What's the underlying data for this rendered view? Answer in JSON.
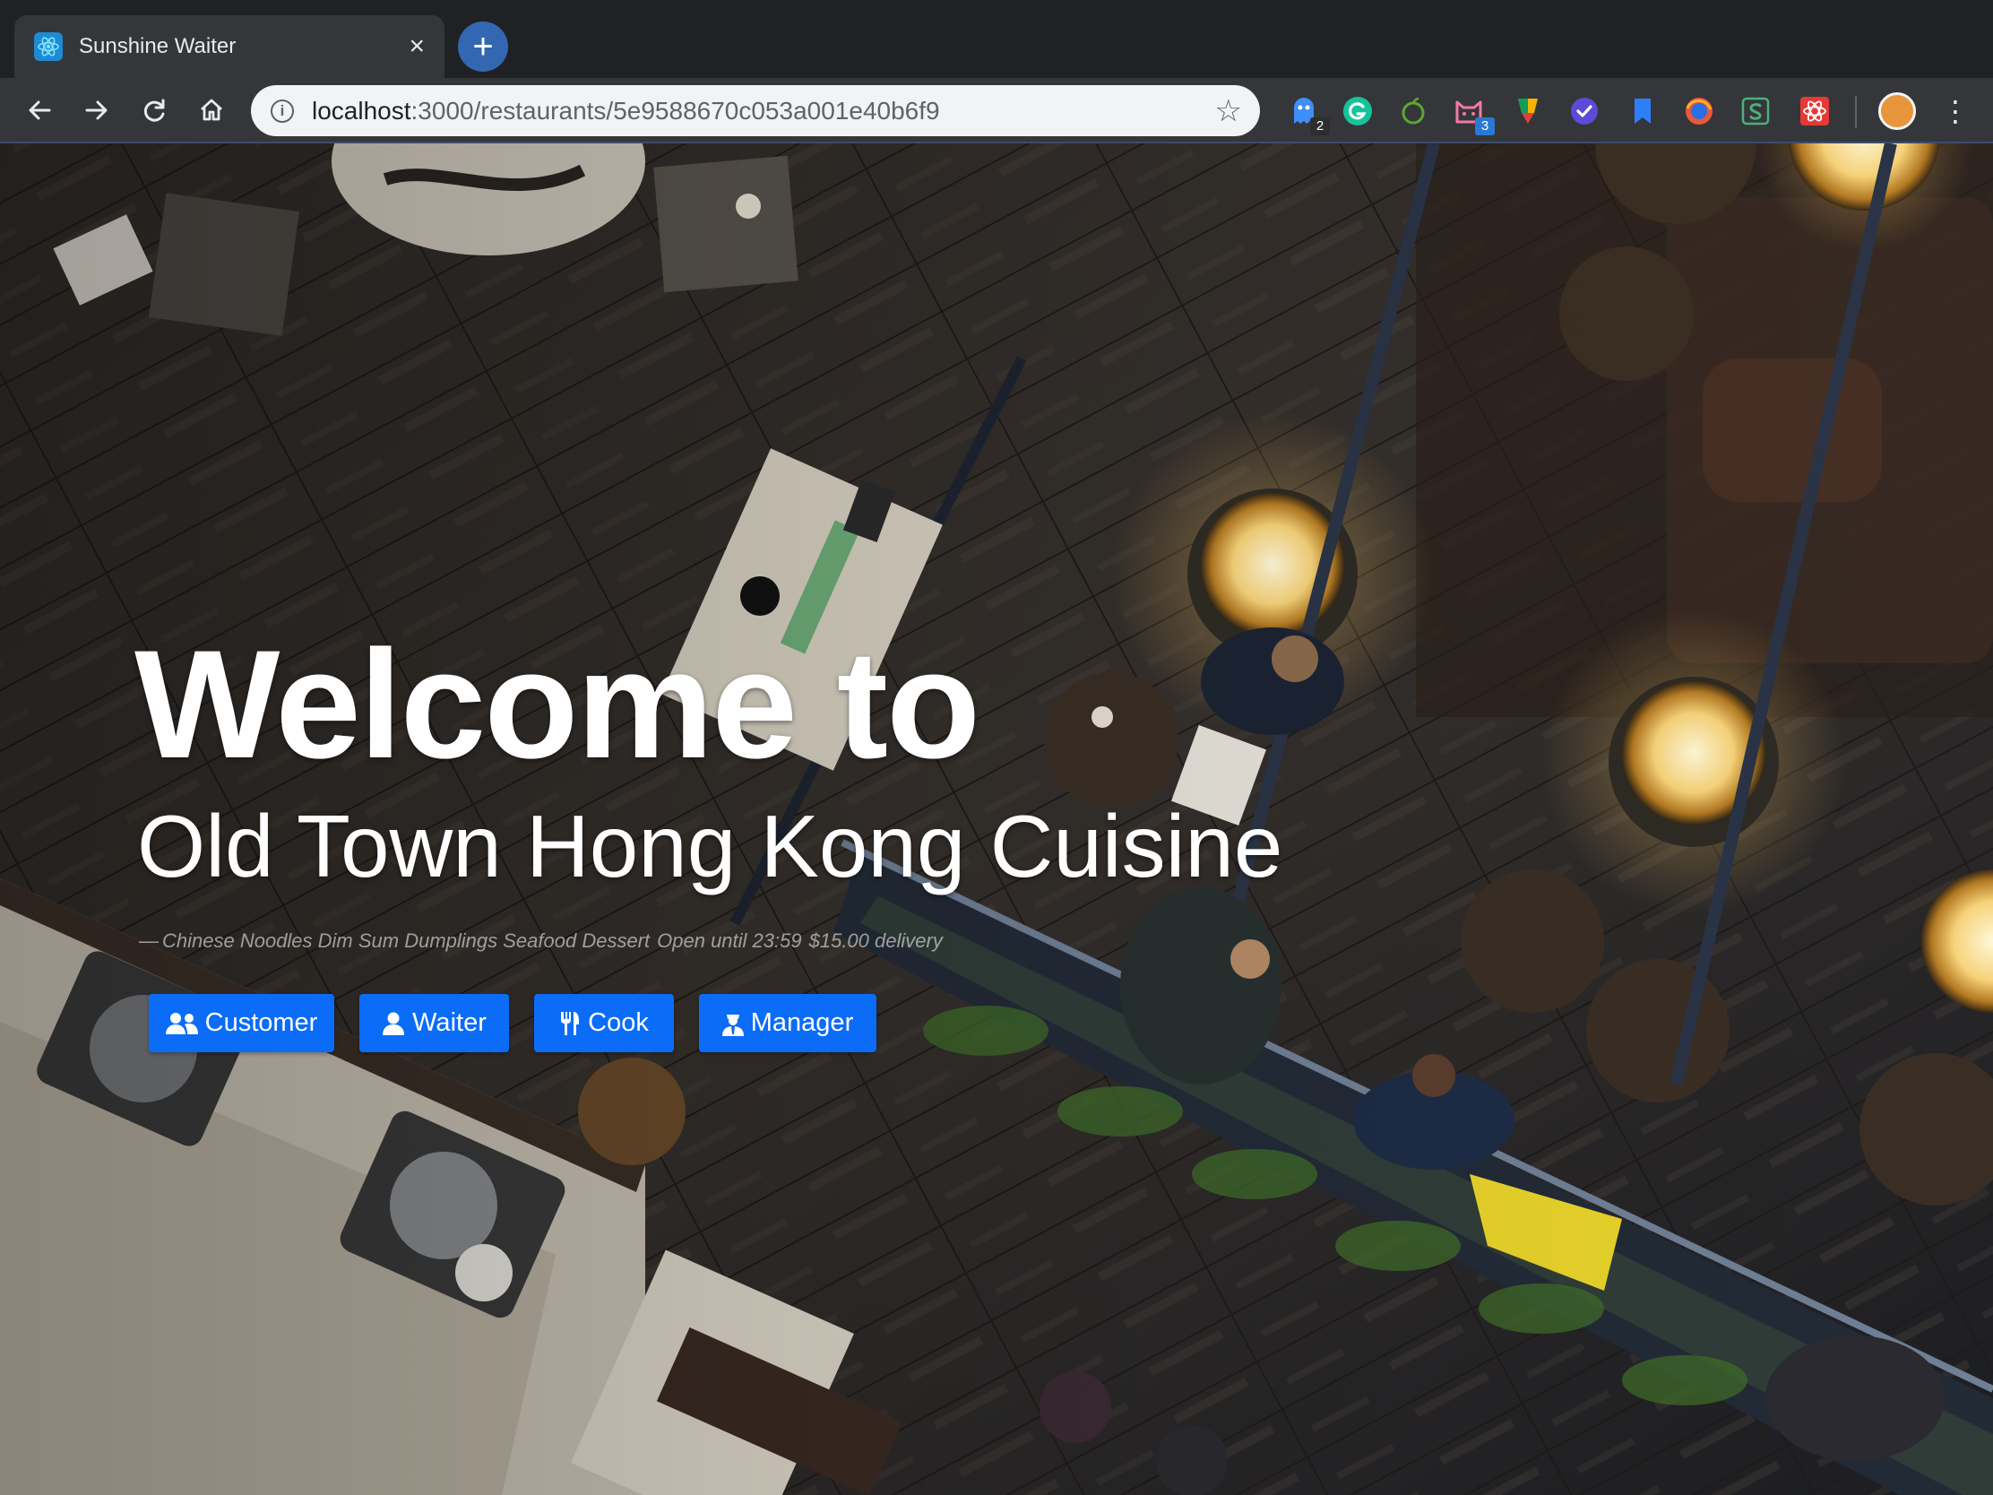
{
  "browser": {
    "tab": {
      "title": "Sunshine Waiter",
      "close_glyph": "×",
      "favicon": "react-icon"
    },
    "new_tab_glyph": "+",
    "address_bar": {
      "host": "localhost",
      "path": ":3000/restaurants/5e9588670c053a001e40b6f9"
    },
    "extensions": [
      {
        "name": "ghost-extension-icon",
        "badge": "2"
      },
      {
        "name": "grammarly-extension-icon",
        "badge": ""
      },
      {
        "name": "apple-extension-icon",
        "badge": ""
      },
      {
        "name": "cat-extension-icon",
        "badge": "3"
      },
      {
        "name": "google-keep-extension-icon",
        "badge": ""
      },
      {
        "name": "check-extension-icon",
        "badge": ""
      },
      {
        "name": "bookmark-extension-icon",
        "badge": ""
      },
      {
        "name": "firefox-extension-icon",
        "badge": ""
      },
      {
        "name": "s-extension-icon",
        "badge": ""
      },
      {
        "name": "react-devtools-extension-icon",
        "badge": ""
      }
    ],
    "menu_glyph": "⋮"
  },
  "page": {
    "welcome": "Welcome to",
    "restaurant_name": "Old Town Hong Kong Cuisine",
    "subline": {
      "dash": "—",
      "cuisines": "Chinese Noodles Dim Sum Dumplings Seafood Dessert",
      "hours": "Open until 23:59",
      "delivery": "$15.00 delivery"
    },
    "buttons": {
      "customer": "Customer",
      "waiter": "Waiter",
      "cook": "Cook",
      "manager": "Manager"
    }
  },
  "colors": {
    "primary_button": "#0b6cf8",
    "tab_bg": "#35363a",
    "chrome_bg": "#202124"
  }
}
